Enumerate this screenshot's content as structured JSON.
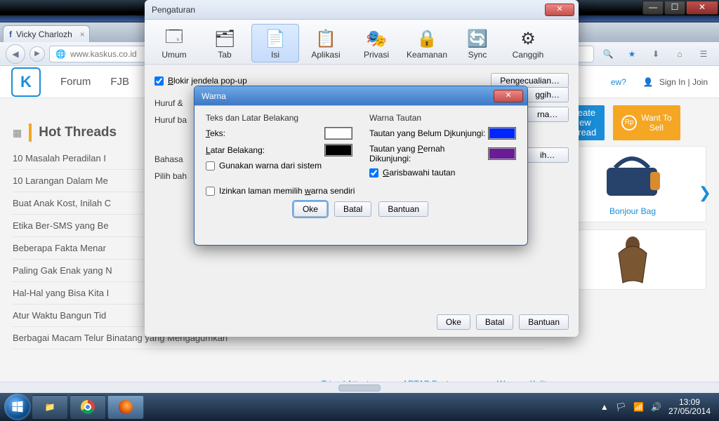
{
  "window": {
    "min": "—",
    "max": "☐",
    "close": "✕"
  },
  "firefox": {
    "tab_fb_label": "Vicky Charlozh",
    "url": "www.kaskus.co.id",
    "toolbar_icons": {
      "back": "◀",
      "fwd": "▶"
    }
  },
  "kaskus": {
    "logo": "K",
    "nav": [
      "Forum",
      "FJB"
    ],
    "right_link": "ew?",
    "signin": "Sign In | Join",
    "btn_blue": "Create\nNew\nThread",
    "btn_orange": "Want To\nSell",
    "hot_title": "Hot Threads",
    "threads": [
      "10 Masalah Peradilan I",
      "10 Larangan Dalam Me",
      "Buat Anak Kost, Inilah C",
      "Etika Ber-SMS yang Be",
      "Beberapa Fakta Menar",
      "Paling Gak Enak yang N",
      "Hal-Hal yang Bisa Kita I",
      "Atur Waktu Bangun Tid",
      "Berbagai Macam Telur Binatang yang Mengagumkan"
    ],
    "card1": "Bonjour Bag",
    "ads": [
      "Tripod Attanta",
      "ARTAP Footwear",
      "Wayang Kulit"
    ]
  },
  "options": {
    "title": "Pengaturan",
    "tabs": [
      {
        "label": "Umum",
        "icon": "🗔"
      },
      {
        "label": "Tab",
        "icon": "🗂"
      },
      {
        "label": "Isi",
        "icon": "📄",
        "active": true
      },
      {
        "label": "Aplikasi",
        "icon": "📋"
      },
      {
        "label": "Privasi",
        "icon": "🎭"
      },
      {
        "label": "Keamanan",
        "icon": "🔒"
      },
      {
        "label": "Sync",
        "icon": "🔄"
      },
      {
        "label": "Canggih",
        "icon": "⚙"
      }
    ],
    "popup_label": "Blokir jendela pop-up",
    "exceptions": "Pengecualian…",
    "section_font": "Huruf &",
    "section_font2": "Huruf ba",
    "side_btns": [
      "ggih…",
      "rna…",
      "ih…"
    ],
    "section_lang": "Bahasa",
    "section_lang2": "Pilih bah",
    "ok": "Oke",
    "cancel": "Batal",
    "help": "Bantuan"
  },
  "warna": {
    "title": "Warna",
    "h_left": "Teks dan Latar Belakang",
    "h_right": "Warna Tautan",
    "teks": "Teks:",
    "latar": "Latar Belakang:",
    "unvisited": "Tautan yang Belum Dikunjungi:",
    "visited": "Tautan yang Pernah Dikunjungi:",
    "chk_sys": "Gunakan warna dari sistem",
    "chk_underline": "Garisbawahi tautan",
    "chk_allow": "Izinkan laman memilih warna sendiri",
    "ok": "Oke",
    "cancel": "Batal",
    "help": "Bantuan",
    "colors": {
      "text": "#ffffff",
      "bg": "#000000",
      "unvisited": "#0026ff",
      "visited": "#6a1b9a"
    }
  },
  "taskbar": {
    "time": "13:09",
    "date": "27/05/2014",
    "tray": [
      "▲",
      "🏳",
      "📶",
      "🔊"
    ]
  }
}
